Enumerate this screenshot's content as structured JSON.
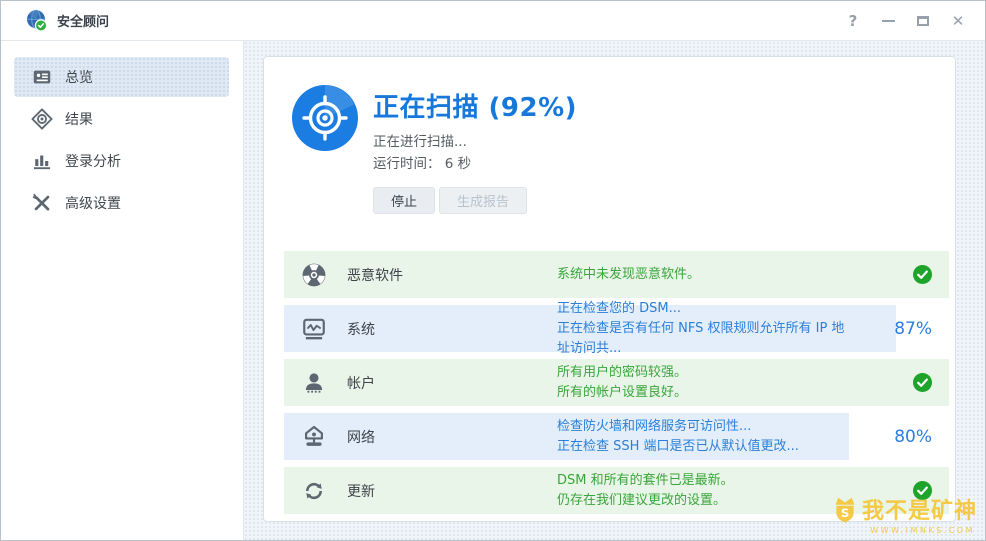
{
  "window": {
    "title": "安全顾问",
    "controls": {
      "help": "?",
      "close": "✕"
    }
  },
  "sidebar": {
    "items": [
      {
        "label": "总览",
        "selected": true
      },
      {
        "label": "结果",
        "selected": false
      },
      {
        "label": "登录分析",
        "selected": false
      },
      {
        "label": "高级设置",
        "selected": false
      }
    ]
  },
  "scan": {
    "title": "正在扫描 (92%)",
    "progress_percent": 92,
    "line1": "正在进行扫描...",
    "line2": "运行时间： 6 秒",
    "buttons": {
      "stop": "停止",
      "report": "生成报告"
    }
  },
  "rows": [
    {
      "label": "恶意软件",
      "lines": [
        "系统中未发现恶意软件。"
      ],
      "state": "ok"
    },
    {
      "label": "系统",
      "lines": [
        "正在检查您的 DSM...",
        "正在检查是否有任何 NFS 权限规则允许所有 IP 地址访问共..."
      ],
      "state": "progress",
      "percent": "87%",
      "fill_pct": 92
    },
    {
      "label": "帐户",
      "lines": [
        "所有用户的密码较强。",
        "所有的帐户设置良好。"
      ],
      "state": "ok"
    },
    {
      "label": "网络",
      "lines": [
        "检查防火墙和网络服务可访问性...",
        "正在检查 SSH 端口是否已从默认值更改..."
      ],
      "state": "progress",
      "percent": "80%",
      "fill_pct": 85
    },
    {
      "label": "更新",
      "lines": [
        "DSM 和所有的套件已是最新。",
        "仍存在我们建议更改的设置。"
      ],
      "state": "ok"
    }
  ],
  "watermark": {
    "text": "我不是矿神",
    "url": "WWW.IMNKS.COM"
  },
  "colors": {
    "accent_blue": "#1778dc",
    "row_blue_bg": "#e4eefa",
    "row_green_bg": "#e9f5e9",
    "green_text": "#3aa53a",
    "blue_text": "#2a7fd8",
    "check_green": "#1ea32b",
    "icon_gray": "#5c6771",
    "watermark_gold": "#f5c330"
  }
}
